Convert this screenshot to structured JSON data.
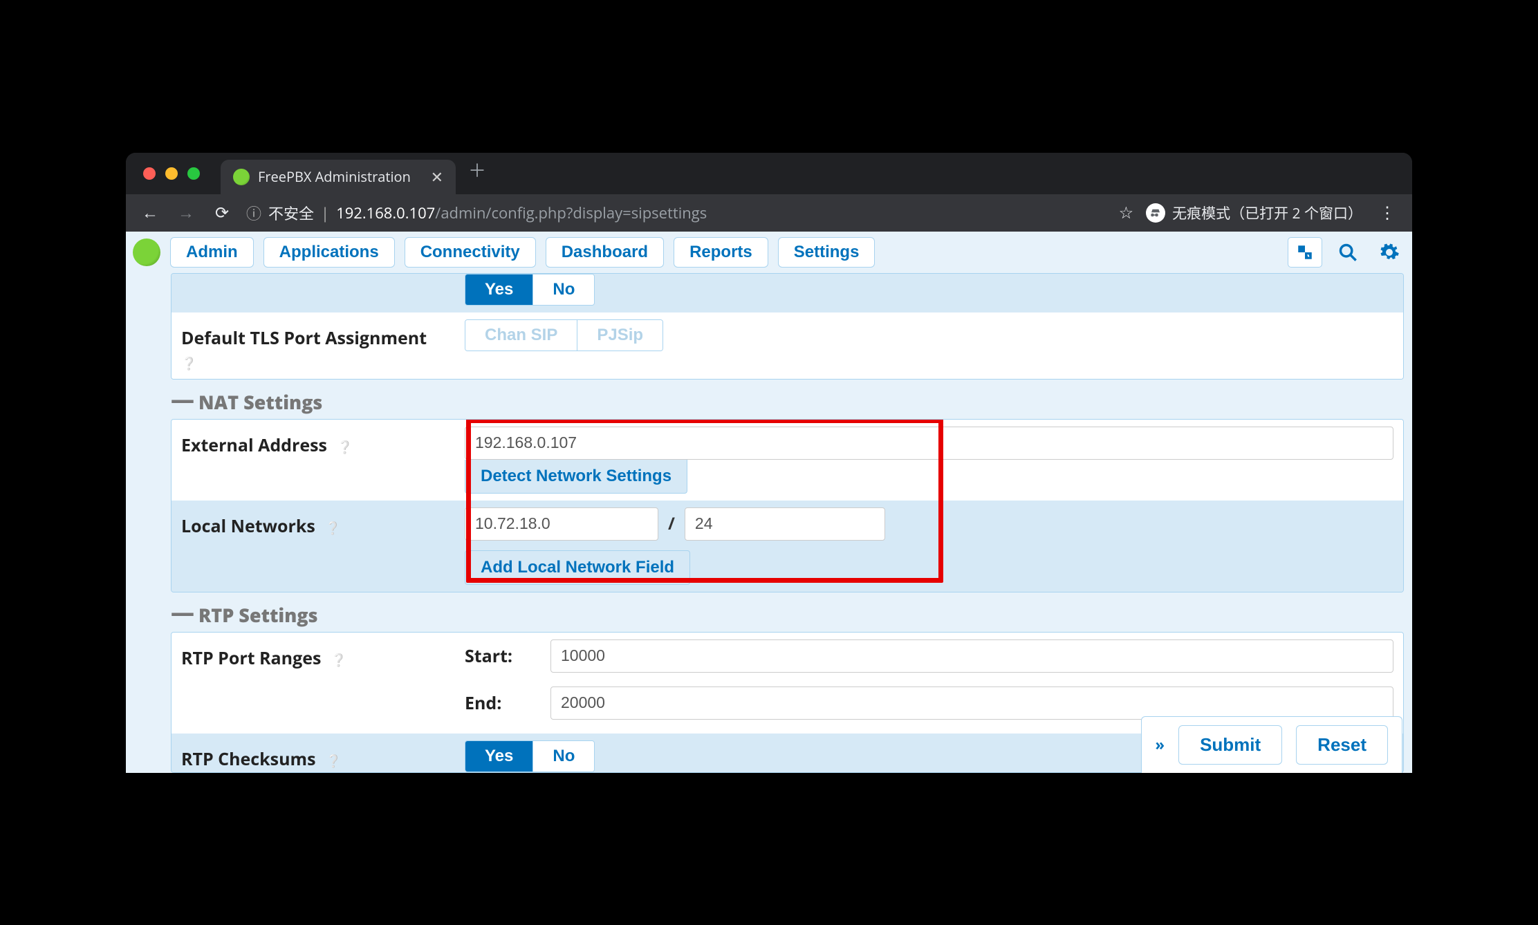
{
  "browser": {
    "tab_title": "FreePBX Administration",
    "security_label": "不安全",
    "url_host": "192.168.0.107",
    "url_rest": "/admin/config.php?display=sipsettings",
    "incognito_label": "无痕模式（已打开 2 个窗口）"
  },
  "nav": {
    "items": [
      "Admin",
      "Applications",
      "Connectivity",
      "Dashboard",
      "Reports",
      "Settings"
    ]
  },
  "settings": {
    "partial_toggle": {
      "yes": "Yes",
      "no": "No",
      "active": "yes"
    },
    "tls_port": {
      "label": "Default TLS Port Assignment",
      "options": [
        "Chan SIP",
        "PJSip"
      ]
    },
    "nat": {
      "header": "NAT Settings",
      "external_address": {
        "label": "External Address",
        "value": "192.168.0.107",
        "detect_btn": "Detect Network Settings"
      },
      "local_networks": {
        "label": "Local Networks",
        "network": "10.72.18.0",
        "cidr": "24",
        "add_btn": "Add Local Network Field"
      }
    },
    "rtp": {
      "header": "RTP Settings",
      "port_ranges": {
        "label": "RTP Port Ranges",
        "start_label": "Start:",
        "end_label": "End:",
        "start": "10000",
        "end": "20000"
      },
      "checksums": {
        "label": "RTP Checksums",
        "yes": "Yes",
        "no": "No",
        "active": "yes"
      }
    }
  },
  "actions": {
    "submit": "Submit",
    "reset": "Reset"
  }
}
